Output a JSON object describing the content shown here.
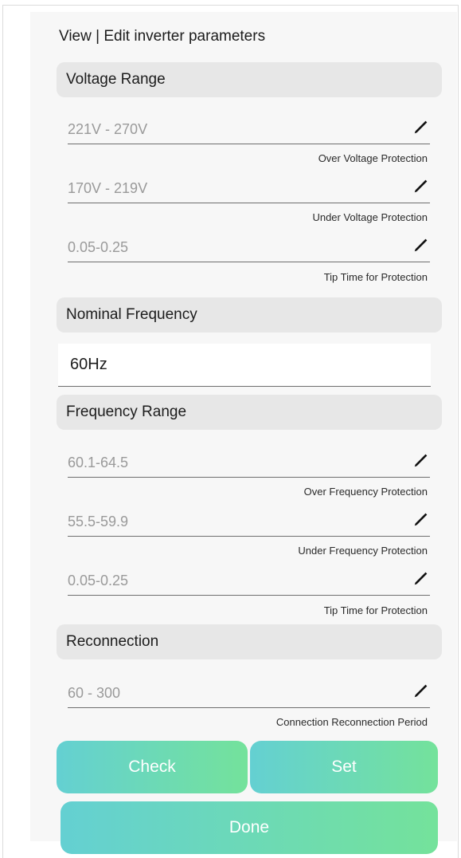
{
  "page_title": "View | Edit inverter parameters",
  "sections": {
    "voltage_range": "Voltage Range",
    "nominal_frequency": "Nominal Frequency",
    "frequency_range": "Frequency Range",
    "reconnection": "Reconnection"
  },
  "voltage_fields": [
    {
      "value": "221V - 270V",
      "caption": "Over Voltage Protection"
    },
    {
      "value": "170V - 219V",
      "caption": "Under Voltage Protection"
    },
    {
      "value": "0.05-0.25",
      "caption": "Tip Time for Protection"
    }
  ],
  "nominal_frequency_value": "60Hz",
  "frequency_fields": [
    {
      "value": "60.1-64.5",
      "caption": "Over Frequency Protection"
    },
    {
      "value": "55.5-59.9",
      "caption": "Under Frequency Protection"
    },
    {
      "value": "0.05-0.25",
      "caption": "Tip Time for Protection"
    }
  ],
  "reconnection_field": {
    "value": "60 - 300",
    "caption": "Connection Reconnection Period"
  },
  "buttons": {
    "check": "Check",
    "set": "Set",
    "done": "Done"
  },
  "icons": {
    "edit": "pencil-icon"
  },
  "colors": {
    "button_gradient_start": "#64d0d2",
    "button_gradient_end": "#74e29b",
    "section_header_bg": "#e7e7e7",
    "panel_bg": "#f7f7f7"
  }
}
